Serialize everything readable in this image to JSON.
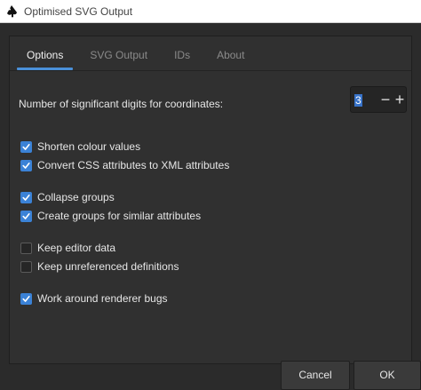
{
  "window": {
    "title": "Optimised SVG Output"
  },
  "tabs": [
    {
      "label": "Options",
      "active": true
    },
    {
      "label": "SVG Output",
      "active": false
    },
    {
      "label": "IDs",
      "active": false
    },
    {
      "label": "About",
      "active": false
    }
  ],
  "precision": {
    "label": "Number of significant digits for coordinates:",
    "value": "3",
    "decrement": "−",
    "increment": "+"
  },
  "options": [
    {
      "label": "Shorten colour values",
      "checked": true
    },
    {
      "label": "Convert CSS attributes to XML attributes",
      "checked": true
    },
    {
      "label": "Collapse groups",
      "checked": true
    },
    {
      "label": "Create groups for similar attributes",
      "checked": true
    },
    {
      "label": "Keep editor data",
      "checked": false
    },
    {
      "label": "Keep unreferenced definitions",
      "checked": false
    },
    {
      "label": "Work around renderer bugs",
      "checked": true
    }
  ],
  "buttons": {
    "cancel": "Cancel",
    "ok": "OK"
  },
  "colors": {
    "accent": "#3b82d6",
    "background": "#2b2b2b",
    "titlebar": "#ffffff"
  },
  "icons": {
    "app": "inkscape-icon",
    "check": "checkmark-icon"
  }
}
